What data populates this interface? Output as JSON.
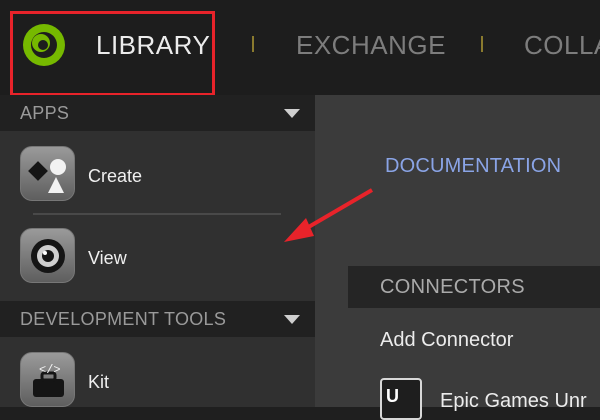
{
  "topnav": {
    "items": [
      {
        "label": "LIBRARY",
        "active": true
      },
      {
        "label": "EXCHANGE",
        "active": false
      },
      {
        "label": "COLLA",
        "active": false
      }
    ],
    "logo": "nvidia-omniverse-logo"
  },
  "sidebar": {
    "sections": [
      {
        "label": "APPS",
        "items": [
          {
            "label": "Create",
            "icon": "create-shapes-icon"
          },
          {
            "label": "View",
            "icon": "view-aperture-icon"
          }
        ]
      },
      {
        "label": "DEVELOPMENT TOOLS",
        "items": [
          {
            "label": "Kit",
            "icon": "kit-toolbox-icon"
          }
        ]
      }
    ]
  },
  "main": {
    "documentation_link": "DOCUMENTATION",
    "connectors_header": "CONNECTORS",
    "add_connector": "Add Connector",
    "connector_items": [
      {
        "label": "Epic Games Unr",
        "icon": "unreal-engine-icon"
      }
    ]
  },
  "annotation": {
    "highlight_color": "#e8232a",
    "arrow_color": "#e8232a"
  }
}
